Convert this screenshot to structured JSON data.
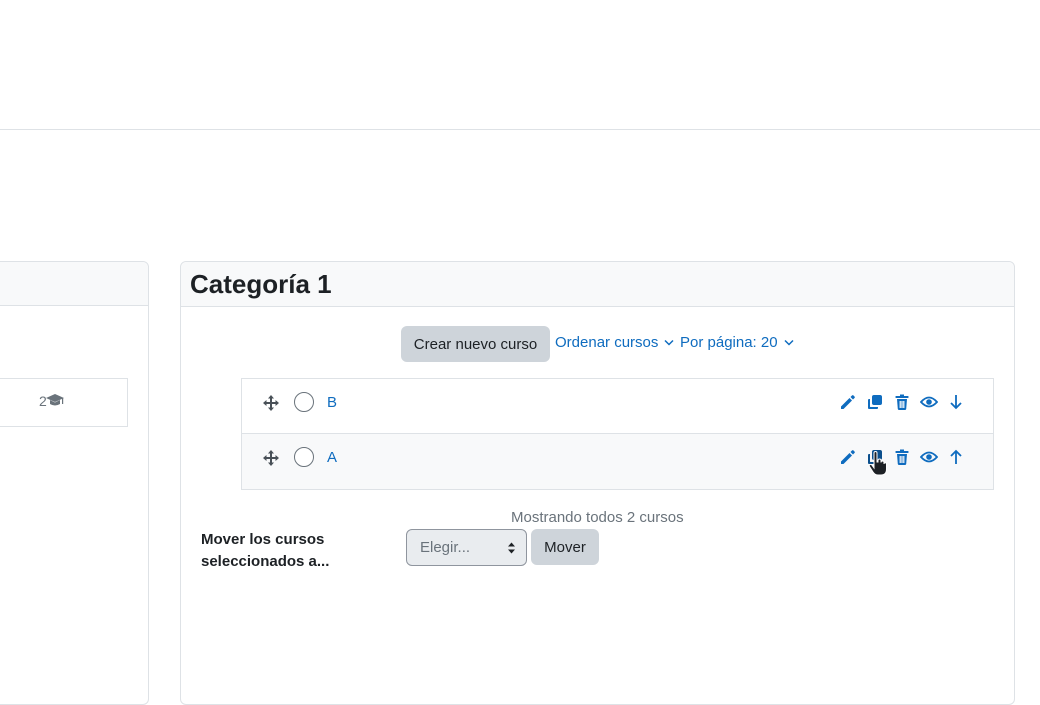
{
  "left_panel": {
    "course_count": "2"
  },
  "category": {
    "title": "Categoría 1",
    "create_course_label": "Crear nuevo curso",
    "sort_label": "Ordenar cursos",
    "per_page_label": "Por página: 20",
    "courses": [
      {
        "name": "B",
        "last_action": "move-down"
      },
      {
        "name": "A",
        "last_action": "move-up"
      }
    ],
    "showing_text": "Mostrando todos 2 cursos",
    "move_label": "Mover los cursos seleccionados a...",
    "select_placeholder": "Elegir...",
    "move_button_label": "Mover"
  },
  "colors": {
    "link": "#0f6cbf",
    "secondary_button": "#ced4da",
    "muted_text": "#6a737b"
  }
}
